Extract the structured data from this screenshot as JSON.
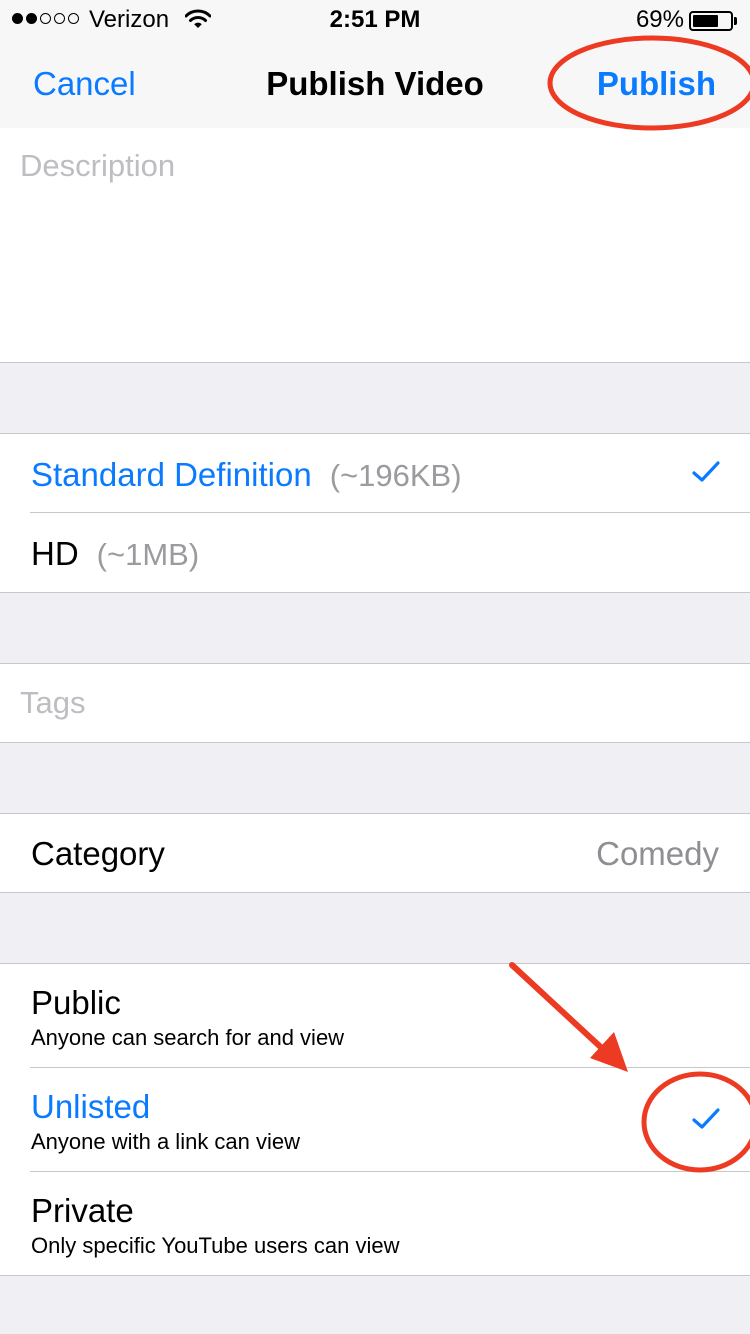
{
  "status_bar": {
    "carrier": "Verizon",
    "time": "2:51 PM",
    "battery_percent": "69%",
    "battery_level": 0.69,
    "signal_bars_filled": 2,
    "signal_bars_total": 5
  },
  "nav": {
    "cancel_label": "Cancel",
    "title": "Publish Video",
    "publish_label": "Publish"
  },
  "description": {
    "placeholder": "Description",
    "value": ""
  },
  "quality": {
    "options": [
      {
        "label": "Standard Definition",
        "size": "(~196KB)",
        "selected": true
      },
      {
        "label": "HD",
        "size": "(~1MB)",
        "selected": false
      }
    ]
  },
  "tags": {
    "placeholder": "Tags",
    "value": ""
  },
  "category": {
    "label": "Category",
    "value": "Comedy"
  },
  "privacy": {
    "options": [
      {
        "title": "Public",
        "description": "Anyone can search for and view",
        "selected": false
      },
      {
        "title": "Unlisted",
        "description": "Anyone with a link can view",
        "selected": true
      },
      {
        "title": "Private",
        "description": "Only specific YouTube users can view",
        "selected": false
      }
    ]
  },
  "colors": {
    "accent": "#0a7aff",
    "annotation": "#ec3b22",
    "background": "#efeff4"
  },
  "icons": {
    "wifi": "wifi-icon",
    "checkmark": "checkmark-icon",
    "battery": "battery-icon"
  }
}
